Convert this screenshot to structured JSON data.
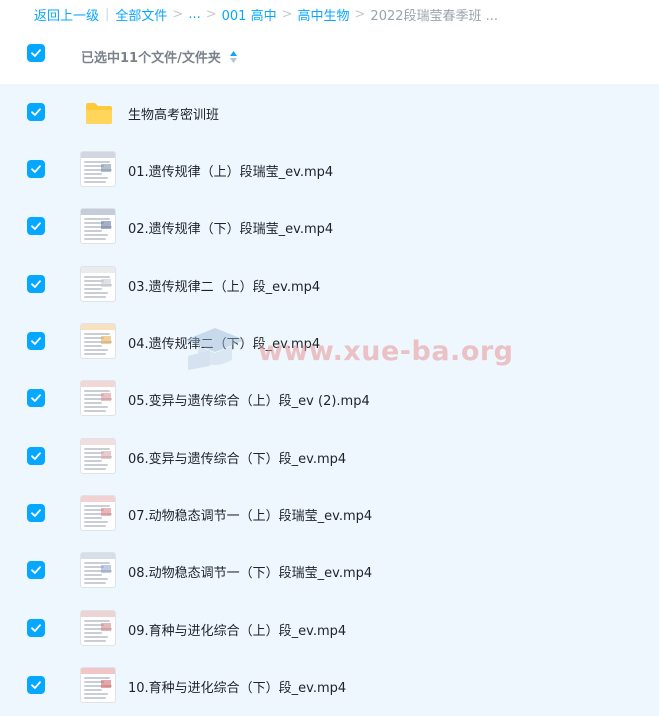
{
  "breadcrumb": {
    "back": "返回上一级",
    "items": [
      "全部文件",
      "...",
      "001 高中",
      "高中生物",
      "2022段瑞莹春季班 ..."
    ]
  },
  "header": {
    "title": "已选中11个文件/文件夹"
  },
  "colors": {
    "accent": "#06a7ff",
    "folder": "#ffc93c",
    "list_bg": "#eef7fd",
    "watermark": "#e89696"
  },
  "files": [
    {
      "name": "生物高考密训班",
      "type": "folder",
      "thumb_accent": ""
    },
    {
      "name": "01.遗传规律（上）段瑞莹_ev.mp4",
      "type": "video",
      "thumb_accent": "#7a8aa5"
    },
    {
      "name": "02.遗传规律（下）段瑞莹_ev.mp4",
      "type": "video",
      "thumb_accent": "#5a6f99"
    },
    {
      "name": "03.遗传规律二（上）段_ev.mp4",
      "type": "video",
      "thumb_accent": "#c2c7cf"
    },
    {
      "name": "04.遗传规律二（下）段_ev.mp4",
      "type": "video",
      "thumb_accent": "#e7a84a"
    },
    {
      "name": "05.变异与遗传综合（上）段_ev (2).mp4",
      "type": "video",
      "thumb_accent": "#d98c8c"
    },
    {
      "name": "06.变异与遗传综合（下）段_ev.mp4",
      "type": "video",
      "thumb_accent": "#d9a0a0"
    },
    {
      "name": "07.动物稳态调节一（上）段瑞莹_ev.mp4",
      "type": "video",
      "thumb_accent": "#d77b7b"
    },
    {
      "name": "08.动物稳态调节一（下）段瑞莹_ev.mp4",
      "type": "video",
      "thumb_accent": "#8aa0c4"
    },
    {
      "name": "09.育种与进化综合（上）段_ev.mp4",
      "type": "video",
      "thumb_accent": "#cf8080"
    },
    {
      "name": "10.育种与进化综合（下）段_ev.mp4",
      "type": "video",
      "thumb_accent": "#d55b5b"
    }
  ],
  "watermark": "www.xue-ba.org"
}
